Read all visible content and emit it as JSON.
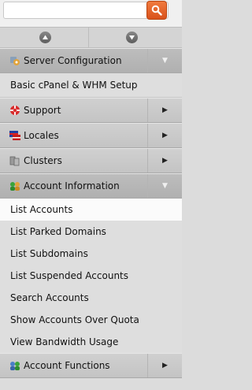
{
  "search": {
    "placeholder": "",
    "icon": "search-icon"
  },
  "scroll": {
    "up_icon": "chevron-up-icon",
    "down_icon": "chevron-down-icon"
  },
  "menu": {
    "server_config": {
      "label": "Server Configuration",
      "icon": "gear-icon"
    },
    "server_config_items": [
      "Basic cPanel & WHM Setup"
    ],
    "support": {
      "label": "Support",
      "icon": "lifebuoy-icon"
    },
    "locales": {
      "label": "Locales",
      "icon": "flag-icon"
    },
    "clusters": {
      "label": "Clusters",
      "icon": "servers-icon"
    },
    "account_info": {
      "label": "Account Information",
      "icon": "users-icon"
    },
    "account_info_items": [
      "List Accounts",
      "List Parked Domains",
      "List Subdomains",
      "List Suspended Accounts",
      "Search Accounts",
      "Show Accounts Over Quota",
      "View Bandwidth Usage"
    ],
    "account_functions": {
      "label": "Account Functions",
      "icon": "users-gear-icon"
    }
  },
  "colors": {
    "search_button": "#e8642a",
    "selected_row": "#fbfbfb"
  }
}
